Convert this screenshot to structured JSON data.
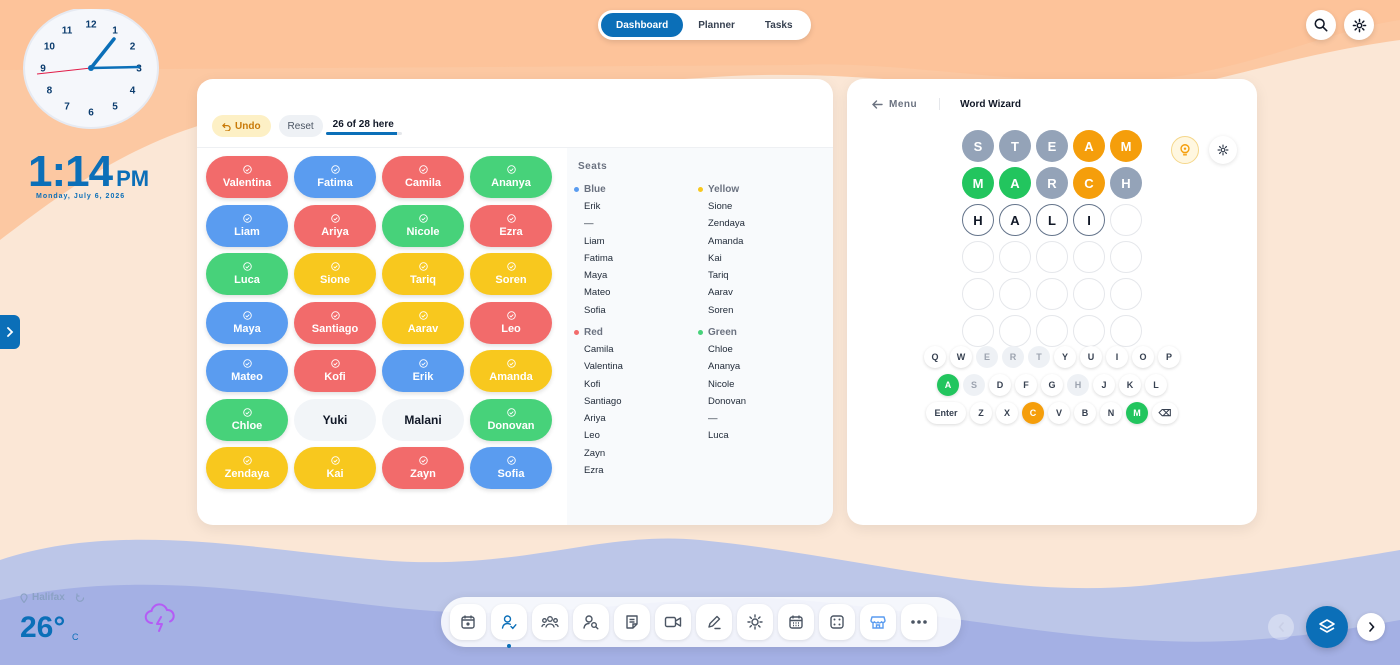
{
  "top_nav": {
    "tabs": [
      "Dashboard",
      "Planner",
      "Tasks"
    ],
    "active": "Dashboard"
  },
  "clock": {
    "time": "1:14",
    "ampm": "PM",
    "date": "Monday, July 6, 2026",
    "numerals": [
      "12",
      "1",
      "2",
      "3",
      "4",
      "5",
      "6",
      "7",
      "8",
      "9",
      "10",
      "11"
    ]
  },
  "seating": {
    "undo_label": "Undo",
    "reset_label": "Reset",
    "attendance": "26 of 28 here",
    "attendance_fraction": 0.93,
    "seats": [
      {
        "name": "Valentina",
        "color": "red",
        "checked": true
      },
      {
        "name": "Fatima",
        "color": "blue",
        "checked": true
      },
      {
        "name": "Camila",
        "color": "red",
        "checked": true
      },
      {
        "name": "Ananya",
        "color": "green",
        "checked": true
      },
      {
        "name": "Liam",
        "color": "blue",
        "checked": true
      },
      {
        "name": "Ariya",
        "color": "red",
        "checked": true
      },
      {
        "name": "Nicole",
        "color": "green",
        "checked": true
      },
      {
        "name": "Ezra",
        "color": "red",
        "checked": true
      },
      {
        "name": "Luca",
        "color": "green",
        "checked": true
      },
      {
        "name": "Sione",
        "color": "yellow",
        "checked": true
      },
      {
        "name": "Tariq",
        "color": "yellow",
        "checked": true
      },
      {
        "name": "Soren",
        "color": "yellow",
        "checked": true
      },
      {
        "name": "Maya",
        "color": "blue",
        "checked": true
      },
      {
        "name": "Santiago",
        "color": "red",
        "checked": true
      },
      {
        "name": "Aarav",
        "color": "yellow",
        "checked": true
      },
      {
        "name": "Leo",
        "color": "red",
        "checked": true
      },
      {
        "name": "Mateo",
        "color": "blue",
        "checked": true
      },
      {
        "name": "Kofi",
        "color": "red",
        "checked": true
      },
      {
        "name": "Erik",
        "color": "blue",
        "checked": true
      },
      {
        "name": "Amanda",
        "color": "yellow",
        "checked": true
      },
      {
        "name": "Chloe",
        "color": "green",
        "checked": true
      },
      {
        "name": "Yuki",
        "color": "empty",
        "checked": false
      },
      {
        "name": "Malani",
        "color": "empty",
        "checked": false
      },
      {
        "name": "Donovan",
        "color": "green",
        "checked": true
      },
      {
        "name": "Zendaya",
        "color": "yellow",
        "checked": true
      },
      {
        "name": "Kai",
        "color": "yellow",
        "checked": true
      },
      {
        "name": "Zayn",
        "color": "red",
        "checked": true
      },
      {
        "name": "Sofia",
        "color": "blue",
        "checked": true
      }
    ],
    "list_title": "Seats",
    "groups": [
      {
        "name": "Blue",
        "color": "#5a9cf0",
        "members": [
          "Erik",
          "—",
          "Liam",
          "Fatima",
          "Maya",
          "Mateo",
          "Sofia"
        ]
      },
      {
        "name": "Yellow",
        "color": "#f8c81e",
        "members": [
          "Sione",
          "Zendaya",
          "Amanda",
          "Kai",
          "Tariq",
          "Aarav",
          "Soren"
        ]
      },
      {
        "name": "Red",
        "color": "#f26b6b",
        "members": [
          "Camila",
          "Valentina",
          "Kofi",
          "Santiago",
          "Ariya",
          "Leo",
          "Zayn",
          "Ezra"
        ]
      },
      {
        "name": "Green",
        "color": "#47d27a",
        "members": [
          "Chloe",
          "Ananya",
          "Nicole",
          "Donovan",
          "—",
          "Luca"
        ]
      }
    ]
  },
  "word_wizard": {
    "menu_label": "Menu",
    "title": "Word Wizard",
    "rows": [
      [
        {
          "l": "S",
          "s": "absent"
        },
        {
          "l": "T",
          "s": "absent"
        },
        {
          "l": "E",
          "s": "absent"
        },
        {
          "l": "A",
          "s": "present"
        },
        {
          "l": "M",
          "s": "present"
        }
      ],
      [
        {
          "l": "M",
          "s": "correct"
        },
        {
          "l": "A",
          "s": "correct"
        },
        {
          "l": "R",
          "s": "absent"
        },
        {
          "l": "C",
          "s": "present"
        },
        {
          "l": "H",
          "s": "absent"
        }
      ],
      [
        {
          "l": "H",
          "s": "typed"
        },
        {
          "l": "A",
          "s": "typed"
        },
        {
          "l": "L",
          "s": "typed"
        },
        {
          "l": "I",
          "s": "typed"
        },
        {
          "l": "",
          "s": "blank"
        }
      ],
      [
        {
          "l": "",
          "s": "blank"
        },
        {
          "l": "",
          "s": "blank"
        },
        {
          "l": "",
          "s": "blank"
        },
        {
          "l": "",
          "s": "blank"
        },
        {
          "l": "",
          "s": "blank"
        }
      ],
      [
        {
          "l": "",
          "s": "blank"
        },
        {
          "l": "",
          "s": "blank"
        },
        {
          "l": "",
          "s": "blank"
        },
        {
          "l": "",
          "s": "blank"
        },
        {
          "l": "",
          "s": "blank"
        }
      ],
      [
        {
          "l": "",
          "s": "blank"
        },
        {
          "l": "",
          "s": "blank"
        },
        {
          "l": "",
          "s": "blank"
        },
        {
          "l": "",
          "s": "blank"
        },
        {
          "l": "",
          "s": "blank"
        }
      ]
    ],
    "keyboard": [
      [
        {
          "k": "Q",
          "s": ""
        },
        {
          "k": "W",
          "s": ""
        },
        {
          "k": "E",
          "s": "absent"
        },
        {
          "k": "R",
          "s": "absent"
        },
        {
          "k": "T",
          "s": "absent"
        },
        {
          "k": "Y",
          "s": ""
        },
        {
          "k": "U",
          "s": ""
        },
        {
          "k": "I",
          "s": ""
        },
        {
          "k": "O",
          "s": ""
        },
        {
          "k": "P",
          "s": ""
        }
      ],
      [
        {
          "k": "A",
          "s": "correct"
        },
        {
          "k": "S",
          "s": "absent"
        },
        {
          "k": "D",
          "s": ""
        },
        {
          "k": "F",
          "s": ""
        },
        {
          "k": "G",
          "s": ""
        },
        {
          "k": "H",
          "s": "absent"
        },
        {
          "k": "J",
          "s": ""
        },
        {
          "k": "K",
          "s": ""
        },
        {
          "k": "L",
          "s": ""
        }
      ],
      [
        {
          "k": "Enter",
          "s": "wide"
        },
        {
          "k": "Z",
          "s": ""
        },
        {
          "k": "X",
          "s": ""
        },
        {
          "k": "C",
          "s": "present"
        },
        {
          "k": "V",
          "s": ""
        },
        {
          "k": "B",
          "s": ""
        },
        {
          "k": "N",
          "s": ""
        },
        {
          "k": "M",
          "s": "correct"
        },
        {
          "k": "⌫",
          "s": "backspace"
        }
      ]
    ]
  },
  "weather": {
    "location": "Halifax",
    "temp": "26°",
    "unit": "C",
    "icon": "thunderstorm-icon"
  },
  "dock": {
    "items": [
      "calendar-star-icon",
      "attendance-icon",
      "groups-icon",
      "name-picker-icon",
      "notes-icon",
      "video-icon",
      "draw-icon",
      "brightness-icon",
      "calendar-icon",
      "dice-icon",
      "store-icon",
      "more-icon"
    ],
    "active": "attendance-icon"
  }
}
